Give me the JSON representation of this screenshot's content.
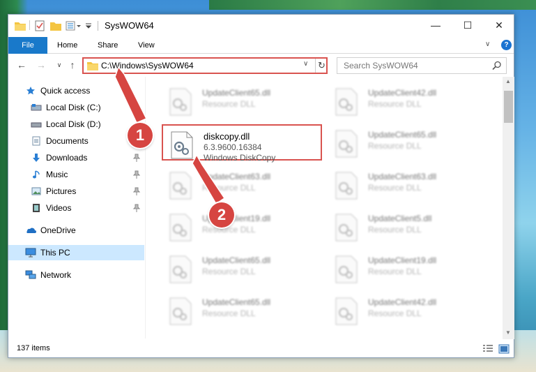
{
  "window": {
    "title": "SysWOW64",
    "minimize_glyph": "—",
    "maximize_glyph": "☐",
    "close_glyph": "✕"
  },
  "ribbon": {
    "tabs": [
      {
        "label": "File"
      },
      {
        "label": "Home"
      },
      {
        "label": "Share"
      },
      {
        "label": "View"
      }
    ],
    "expand_glyph": "∨",
    "help_glyph": "?"
  },
  "navigation": {
    "back_glyph": "←",
    "forward_glyph": "→",
    "recent_glyph": "∨",
    "up_glyph": "↑",
    "address": "C:\\Windows\\SysWOW64",
    "address_dropdown_glyph": "∨",
    "refresh_glyph": "↻",
    "search_placeholder": "Search SysWOW64"
  },
  "sidebar": {
    "items": [
      {
        "label": "Quick access",
        "icon": "star-icon",
        "pinned": false
      },
      {
        "label": "Local Disk (C:)",
        "icon": "drive-icon",
        "pinned": true
      },
      {
        "label": "Local Disk (D:)",
        "icon": "drive-icon",
        "pinned": false
      },
      {
        "label": "Documents",
        "icon": "documents-icon",
        "pinned": true
      },
      {
        "label": "Downloads",
        "icon": "downloads-icon",
        "pinned": true
      },
      {
        "label": "Music",
        "icon": "music-icon",
        "pinned": true
      },
      {
        "label": "Pictures",
        "icon": "pictures-icon",
        "pinned": true
      },
      {
        "label": "Videos",
        "icon": "videos-icon",
        "pinned": true
      },
      {
        "label": "OneDrive",
        "icon": "onedrive-icon",
        "pinned": false
      },
      {
        "label": "This PC",
        "icon": "computer-icon",
        "pinned": false,
        "selected": true
      },
      {
        "label": "Network",
        "icon": "network-icon",
        "pinned": false
      }
    ]
  },
  "files": [
    {
      "name": "UpdateClient65.dll",
      "line2": "Resource DLL",
      "line3": ""
    },
    {
      "name": "UpdateClient42.dll",
      "line2": "Resource DLL",
      "line3": ""
    },
    {
      "name": "diskcopy.dll",
      "line2": "6.3.9600.16384",
      "line3": "Windows DiskCopy",
      "highlighted": true
    },
    {
      "name": "UpdateClient65.dll",
      "line2": "Resource DLL",
      "line3": ""
    },
    {
      "name": "UpdateClient63.dll",
      "line2": "Resource DLL",
      "line3": ""
    },
    {
      "name": "UpdateClient63.dll",
      "line2": "Resource DLL",
      "line3": ""
    },
    {
      "name": "UpdateClient19.dll",
      "line2": "Resource DLL",
      "line3": ""
    },
    {
      "name": "UpdateClient5.dll",
      "line2": "Resource DLL",
      "line3": ""
    },
    {
      "name": "UpdateClient65.dll",
      "line2": "Resource DLL",
      "line3": ""
    },
    {
      "name": "UpdateClient19.dll",
      "line2": "Resource DLL",
      "line3": ""
    },
    {
      "name": "UpdateClient65.dll",
      "line2": "Resource DLL",
      "line3": ""
    },
    {
      "name": "UpdateClient42.dll",
      "line2": "Resource DLL",
      "line3": ""
    }
  ],
  "status": {
    "item_count": "137 items"
  },
  "annotations": {
    "step1": "1",
    "step2": "2",
    "color": "#d64541"
  },
  "colors": {
    "accent": "#1979ca",
    "selection": "#cce8ff",
    "highlight_border": "#d9534f"
  }
}
